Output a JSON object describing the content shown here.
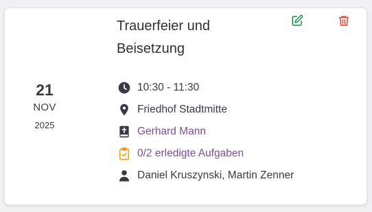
{
  "colors": {
    "edit": "#1f8a4c",
    "delete": "#e0453a",
    "link": "#7a4ea0",
    "task": "#f0a020",
    "icon": "#3a3a46"
  },
  "event": {
    "date": {
      "day": "21",
      "month": "NOV",
      "year": "2025"
    },
    "title": "Trauerfeier und Beisetzung",
    "time": "10:30 - 11:30",
    "location": "Friedhof Stadtmitte",
    "deceased": "Gerhard Mann",
    "tasks": "0/2 erledigte Aufgaben",
    "staff": "Daniel Kruszynski, Martin Zenner"
  },
  "icons": {
    "edit": "edit-icon",
    "delete": "trash-icon",
    "time": "clock-icon",
    "location": "map-pin-icon",
    "deceased": "bible-icon",
    "tasks": "clipboard-check-icon",
    "staff": "person-icon"
  }
}
